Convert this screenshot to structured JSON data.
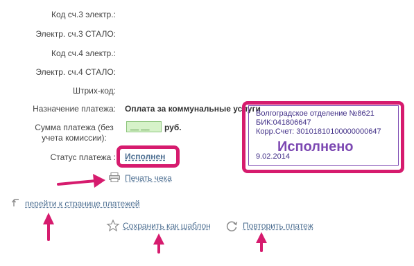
{
  "form": {
    "fields": [
      {
        "label": "Код сч.3 электр.:"
      },
      {
        "label": "Электр. сч.3 СТАЛО:"
      },
      {
        "label": "Код сч.4 электр.:"
      },
      {
        "label": "Электр. сч.4 СТАЛО:"
      },
      {
        "label": "Штрих-код:"
      }
    ],
    "purpose_label": "Назначение платежа:",
    "purpose_value": "Оплата за коммунальные услуги",
    "amount_label": "Сумма платежа (без учета комиссии):",
    "amount_value": "__ __",
    "amount_unit": "руб.",
    "status_label": "Статус платежа :",
    "status_value": "Исполнен"
  },
  "stamp": {
    "line1": "Волгоградское отделение №8621",
    "line2": "БИК:041806647",
    "line3": "Корр.Счет: 30101810100000000647",
    "big_text": "Исполнено",
    "date": "9.02.2014"
  },
  "actions": {
    "print_receipt": "Печать чека",
    "go_to_payments": "перейти к странице платежей",
    "save_template": "Сохранить как шаблон",
    "repeat_payment": "Повторить платеж"
  },
  "colors": {
    "annotation": "#d61b6e",
    "link": "#4c6e91",
    "stamp": "#7c48b2"
  }
}
